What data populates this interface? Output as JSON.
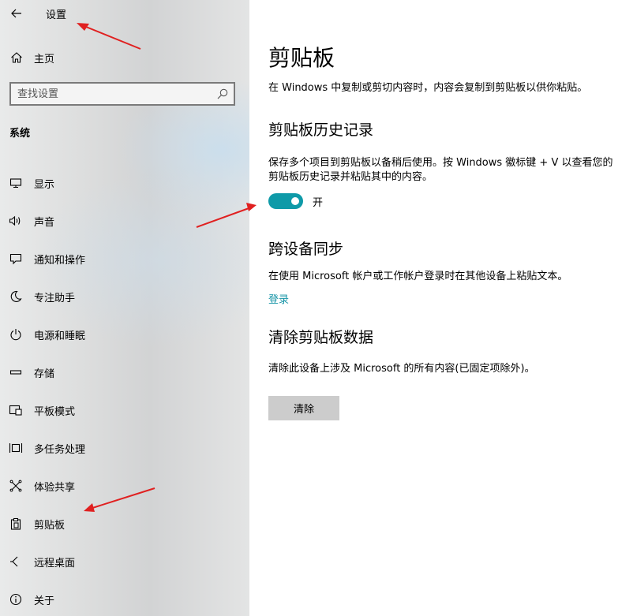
{
  "window": {
    "title": "设置"
  },
  "sidebar": {
    "home_label": "主页",
    "search": {
      "placeholder": "查找设置",
      "value": ""
    },
    "section_heading": "系统",
    "items": [
      {
        "label": "显示",
        "icon": "monitor-icon"
      },
      {
        "label": "声音",
        "icon": "speaker-icon"
      },
      {
        "label": "通知和操作",
        "icon": "notification-icon"
      },
      {
        "label": "专注助手",
        "icon": "moon-icon"
      },
      {
        "label": "电源和睡眠",
        "icon": "power-icon"
      },
      {
        "label": "存储",
        "icon": "storage-icon"
      },
      {
        "label": "平板模式",
        "icon": "tablet-icon"
      },
      {
        "label": "多任务处理",
        "icon": "multitask-icon"
      },
      {
        "label": "体验共享",
        "icon": "share-icon"
      },
      {
        "label": "剪贴板",
        "icon": "clipboard-icon"
      },
      {
        "label": "远程桌面",
        "icon": "remote-desktop-icon"
      },
      {
        "label": "关于",
        "icon": "info-icon"
      }
    ]
  },
  "main": {
    "title": "剪贴板",
    "intro": "在 Windows 中复制或剪切内容时，内容会复制到剪贴板以供你粘贴。",
    "history": {
      "heading": "剪贴板历史记录",
      "description": "保存多个项目到剪贴板以备稍后使用。按 Windows 徽标键 + V 以查看您的剪贴板历史记录并粘贴其中的内容。",
      "toggle_on": true,
      "toggle_state_label": "开"
    },
    "sync": {
      "heading": "跨设备同步",
      "description": "在使用 Microsoft 帐户或工作帐户登录时在其他设备上粘贴文本。",
      "link_label": "登录"
    },
    "clear": {
      "heading": "清除剪贴板数据",
      "description": "清除此设备上涉及 Microsoft 的所有内容(已固定项除外)。",
      "button_label": "清除"
    }
  },
  "colors": {
    "accent": "#0e9aa8",
    "link": "#1493a6",
    "annotation_arrow": "#e02020",
    "button_bg": "#cccccc"
  }
}
